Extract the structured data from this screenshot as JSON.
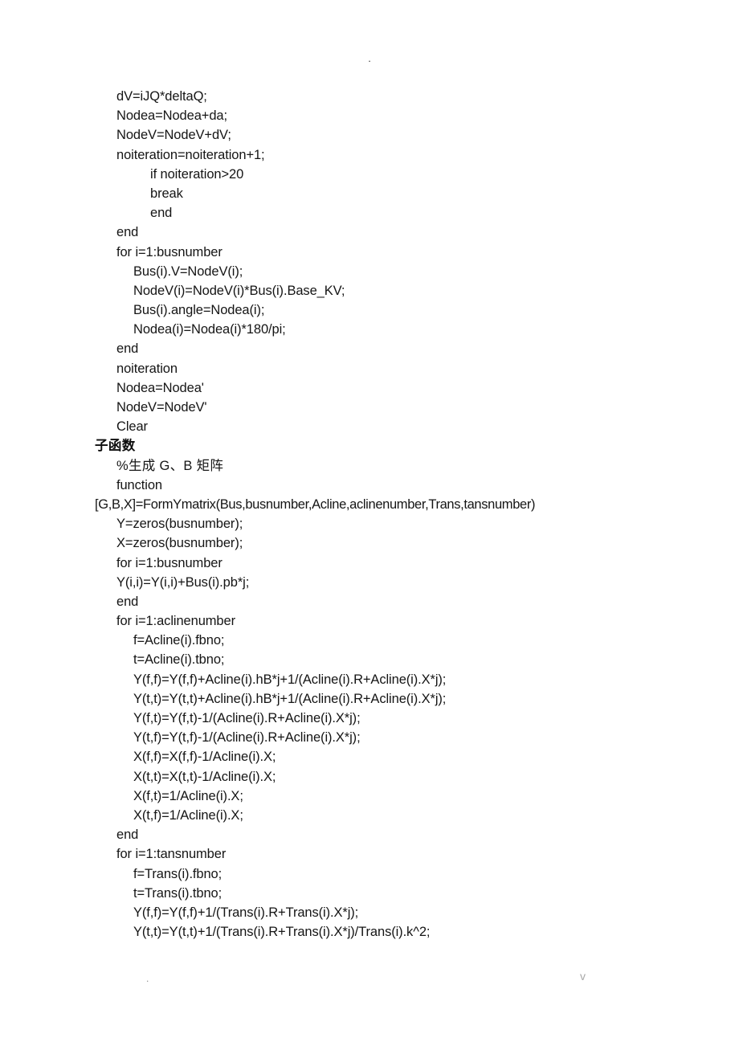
{
  "page": {
    "header_mark": ".",
    "footer_left_mark": ".",
    "footer_right_mark": "v"
  },
  "code": {
    "lines": [
      {
        "indent": 1,
        "text": "dV=iJQ*deltaQ;"
      },
      {
        "indent": 1,
        "text": "Nodea=Nodea+da;"
      },
      {
        "indent": 1,
        "text": "NodeV=NodeV+dV;"
      },
      {
        "indent": 1,
        "text": "noiteration=noiteration+1;"
      },
      {
        "indent": 3,
        "text": "if noiteration>20"
      },
      {
        "indent": 3,
        "text": "break"
      },
      {
        "indent": 3,
        "text": "end"
      },
      {
        "indent": 1,
        "text": "end"
      },
      {
        "indent": 1,
        "text": "for i=1:busnumber"
      },
      {
        "indent": 2,
        "text": "Bus(i).V=NodeV(i);"
      },
      {
        "indent": 2,
        "text": "NodeV(i)=NodeV(i)*Bus(i).Base_KV;"
      },
      {
        "indent": 2,
        "text": "Bus(i).angle=Nodea(i);"
      },
      {
        "indent": 2,
        "text": "Nodea(i)=Nodea(i)*180/pi;"
      },
      {
        "indent": 1,
        "text": "end"
      },
      {
        "indent": 1,
        "text": "noiteration"
      },
      {
        "indent": 1,
        "text": "Nodea=Nodea'"
      },
      {
        "indent": 1,
        "text": "NodeV=NodeV'"
      },
      {
        "indent": 1,
        "text": "Clear"
      },
      {
        "indent": 0,
        "text": "子函数",
        "style": "heading-cn"
      },
      {
        "indent": 1,
        "text": "%生成 G、B 矩阵",
        "style": "comment-cn"
      },
      {
        "indent": 1,
        "text": "function"
      },
      {
        "indent": 0,
        "text": "[G,B,X]=FormYmatrix(Bus,busnumber,Acline,aclinenumber,Trans,tansnumber)",
        "style": "sig-line"
      },
      {
        "indent": 1,
        "text": "Y=zeros(busnumber);"
      },
      {
        "indent": 1,
        "text": "X=zeros(busnumber);"
      },
      {
        "indent": 1,
        "text": "for i=1:busnumber"
      },
      {
        "indent": 1,
        "text": "Y(i,i)=Y(i,i)+Bus(i).pb*j;"
      },
      {
        "indent": 1,
        "text": "end"
      },
      {
        "indent": 1,
        "text": "for i=1:aclinenumber"
      },
      {
        "indent": 2,
        "text": "f=Acline(i).fbno;"
      },
      {
        "indent": 2,
        "text": "t=Acline(i).tbno;"
      },
      {
        "indent": 2,
        "text": "Y(f,f)=Y(f,f)+Acline(i).hB*j+1/(Acline(i).R+Acline(i).X*j);"
      },
      {
        "indent": 2,
        "text": "Y(t,t)=Y(t,t)+Acline(i).hB*j+1/(Acline(i).R+Acline(i).X*j);"
      },
      {
        "indent": 2,
        "text": "Y(f,t)=Y(f,t)-1/(Acline(i).R+Acline(i).X*j);"
      },
      {
        "indent": 2,
        "text": "Y(t,f)=Y(t,f)-1/(Acline(i).R+Acline(i).X*j);"
      },
      {
        "indent": 2,
        "text": "X(f,f)=X(f,f)-1/Acline(i).X;"
      },
      {
        "indent": 2,
        "text": "X(t,t)=X(t,t)-1/Acline(i).X;"
      },
      {
        "indent": 2,
        "text": "X(f,t)=1/Acline(i).X;"
      },
      {
        "indent": 2,
        "text": "X(t,f)=1/Acline(i).X;"
      },
      {
        "indent": 1,
        "text": "end"
      },
      {
        "indent": 1,
        "text": "for i=1:tansnumber"
      },
      {
        "indent": 2,
        "text": "f=Trans(i).fbno;"
      },
      {
        "indent": 2,
        "text": "t=Trans(i).tbno;"
      },
      {
        "indent": 2,
        "text": "Y(f,f)=Y(f,f)+1/(Trans(i).R+Trans(i).X*j);"
      },
      {
        "indent": 2,
        "text": "Y(t,t)=Y(t,t)+1/(Trans(i).R+Trans(i).X*j)/Trans(i).k^2;"
      }
    ]
  }
}
